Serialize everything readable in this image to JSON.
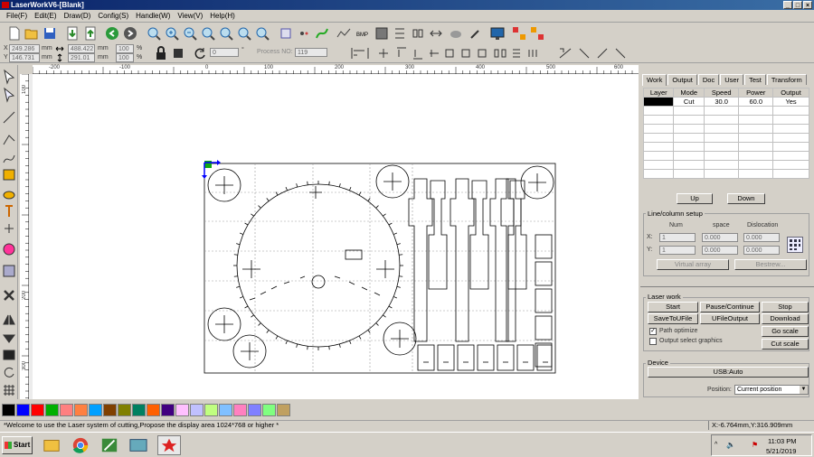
{
  "window": {
    "title": "LaserWorkV6-[Blank]",
    "min": "_",
    "max": "□",
    "close": "×"
  },
  "menu": [
    "File(F)",
    "Edit(E)",
    "Draw(D)",
    "Config(S)",
    "Handle(W)",
    "View(V)",
    "Help(H)"
  ],
  "toolbar2": {
    "x_label": "X",
    "x_value": "249.286",
    "y_label": "Y",
    "y_value": "146.731",
    "mm1": "mm",
    "mm2": "mm",
    "w_value": "488.422",
    "h_value": "291.01",
    "mm3": "mm",
    "mm4": "mm",
    "pct1": "100",
    "pct2": "100",
    "pct_unit1": "%",
    "pct_unit2": "%",
    "rotate_value": "0",
    "deg": "°",
    "process_label": "Process NO:",
    "process_value": "119"
  },
  "hruler": [
    "-200",
    "-100",
    "0",
    "100",
    "200",
    "300",
    "400",
    "500",
    "600"
  ],
  "vruler": [
    "100",
    "200",
    "300"
  ],
  "panel": {
    "tabs": [
      "Work",
      "Output",
      "Doc",
      "User",
      "Test",
      "Transform"
    ],
    "layer_headers": [
      "Layer",
      "Mode",
      "Speed",
      "Power",
      "Output"
    ],
    "layer_row": {
      "mode": "Cut",
      "speed": "30.0",
      "power": "60.0",
      "output": "Yes"
    },
    "layer_color": "#000000",
    "up": "Up",
    "down": "Down",
    "linecol": {
      "title": "Line/column setup",
      "num": "Num",
      "space": "space",
      "dislocation": "Dislocation",
      "x_label": "X:",
      "x_num": "1",
      "x_space": "0.000",
      "x_disl": "0.000",
      "y_label": "Y:",
      "y_num": "1",
      "y_space": "0.000",
      "y_disl": "0.000",
      "virtual_array": "Virtual array",
      "bestrew": "Bestrew..."
    },
    "laser_work": {
      "title": "Laser work",
      "start": "Start",
      "pause": "Pause/Continue",
      "stop": "Stop",
      "save_ufile": "SaveToUFile",
      "ufile_output": "UFileOutput",
      "download": "Download",
      "path_optimize": "Path optimize",
      "output_select": "Output select graphics",
      "go_scale": "Go scale",
      "cut_scale": "Cut scale"
    },
    "device": {
      "title": "Device",
      "usb": "USB:Auto",
      "position_label": "Position:",
      "position_value": "Current position"
    }
  },
  "palette": [
    "#000000",
    "#0000ff",
    "#ff0000",
    "#00b000",
    "#ff8080",
    "#ff8040",
    "#00a0ff",
    "#804000",
    "#808000",
    "#008060",
    "#ff6000",
    "#400080",
    "#ffc0ff",
    "#c0c0ff",
    "#c0ff80",
    "#80c0ff",
    "#ff80c0",
    "#8080ff",
    "#80ff80",
    "#c0a060"
  ],
  "status": {
    "message": "*Welcome to use the Laser system of cutting,Propose the display area 1024*768 or higher *",
    "coords": "X:-6.764mm,Y:316.909mm"
  },
  "taskbar": {
    "start": "Start",
    "time": "11:03 PM",
    "date": "5/21/2019"
  }
}
